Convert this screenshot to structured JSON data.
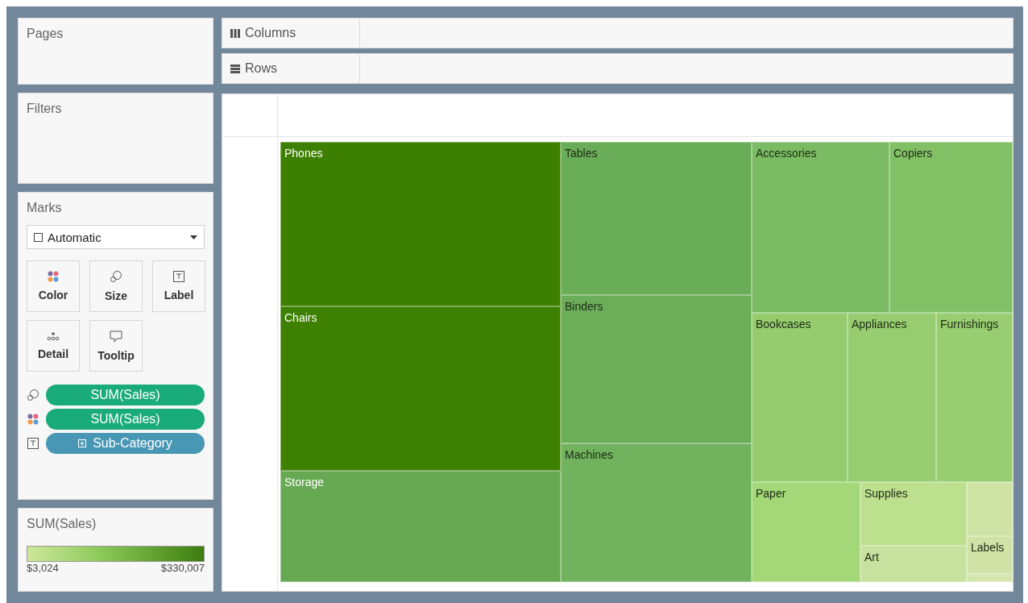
{
  "pages": {
    "title": "Pages"
  },
  "shelves": [
    {
      "kind": "columns",
      "label": "Columns"
    },
    {
      "kind": "rows",
      "label": "Rows"
    }
  ],
  "filters": {
    "title": "Filters"
  },
  "marks": {
    "title": "Marks",
    "mark_type": "Automatic",
    "cards": [
      {
        "kind": "color",
        "label": "Color"
      },
      {
        "kind": "size",
        "label": "Size"
      },
      {
        "kind": "label",
        "label": "Label"
      },
      {
        "kind": "detail",
        "label": "Detail"
      },
      {
        "kind": "tooltip",
        "label": "Tooltip"
      }
    ],
    "pills": [
      {
        "kind": "size",
        "color": "#1aab7b",
        "expandable": false,
        "label": "SUM(Sales)"
      },
      {
        "kind": "color",
        "color": "#1aab7b",
        "expandable": false,
        "label": "SUM(Sales)"
      },
      {
        "kind": "label",
        "color": "#4797b5",
        "expandable": true,
        "label": "Sub-Category"
      }
    ]
  },
  "legend": {
    "title": "SUM(Sales)",
    "min": "$3,024",
    "max": "$330,007"
  },
  "treemap": {
    "tiles": [
      {
        "label": "Phones",
        "color": "#3d7f00"
      },
      {
        "label": "Chairs",
        "color": "#3e8002"
      },
      {
        "label": "Storage",
        "color": "#67a852"
      },
      {
        "label": "Tables",
        "color": "#6aad58"
      },
      {
        "label": "Binders",
        "color": "#6bad59"
      },
      {
        "label": "Machines",
        "color": "#70b25e"
      },
      {
        "label": "Accessories",
        "color": "#7bbb63"
      },
      {
        "label": "Copiers",
        "color": "#82c066"
      },
      {
        "label": "Bookcases",
        "color": "#95cc6e"
      },
      {
        "label": "Appliances",
        "color": "#97cd70"
      },
      {
        "label": "Furnishings",
        "color": "#98ce71"
      },
      {
        "label": "Paper",
        "color": "#a4d778"
      },
      {
        "label": "Supplies",
        "color": "#bde08f"
      },
      {
        "label": "Art",
        "color": "#c7e29e"
      },
      {
        "color": "#cfe3a5"
      },
      {
        "label": "Labels",
        "color": "#d0e2a6"
      },
      {
        "color": "#d4e6ad"
      }
    ]
  }
}
